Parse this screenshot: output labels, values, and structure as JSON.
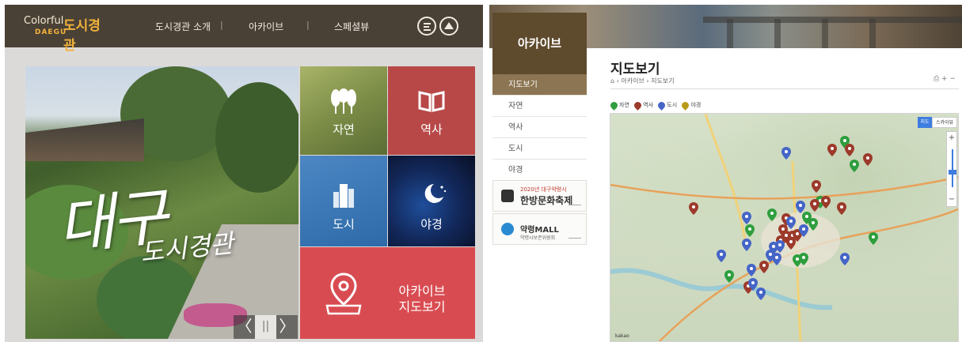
{
  "left": {
    "logo": {
      "brand": "Colorful",
      "brand_sub": "DAEGU",
      "brand_kr": "도시경관"
    },
    "nav": [
      "도시경관 소개",
      "아카이브",
      "스페셜뷰"
    ],
    "nav_separators": [
      "|",
      "|"
    ],
    "hero": {
      "title": "대구",
      "subtitle": "도시경관"
    },
    "slider": {
      "prev": "〈",
      "pause": "||",
      "next": "〉"
    },
    "tiles": {
      "nature": "자연",
      "history": "역사",
      "city": "도시",
      "night": "야경",
      "archive_line1": "아카이브",
      "archive_line2": "지도보기"
    }
  },
  "right": {
    "side_title": "아카이브",
    "side_menu": [
      "지도보기",
      "자연",
      "역사",
      "도시",
      "야경"
    ],
    "promo1": {
      "top": "2020년 대구약령시",
      "title": "한방문화축제"
    },
    "promo2": {
      "title": "약령MALL",
      "sub": "약령시보존위원회"
    },
    "page_title": "지도보기",
    "breadcrumb": [
      "⌂",
      "아카이브",
      "지도보기"
    ],
    "breadcrumb_sep": "›",
    "tools": "⎙ + −",
    "legend": [
      {
        "label": "자연",
        "color": "#2e9e3e"
      },
      {
        "label": "역사",
        "color": "#9c3a2b"
      },
      {
        "label": "도시",
        "color": "#4565c7"
      },
      {
        "label": "야경",
        "color": "#b89b1a"
      }
    ],
    "map": {
      "type_map": "지도",
      "type_sky": "스카이뷰",
      "zoom_in": "+",
      "zoom_out": "−",
      "attribution": "kakao"
    }
  }
}
